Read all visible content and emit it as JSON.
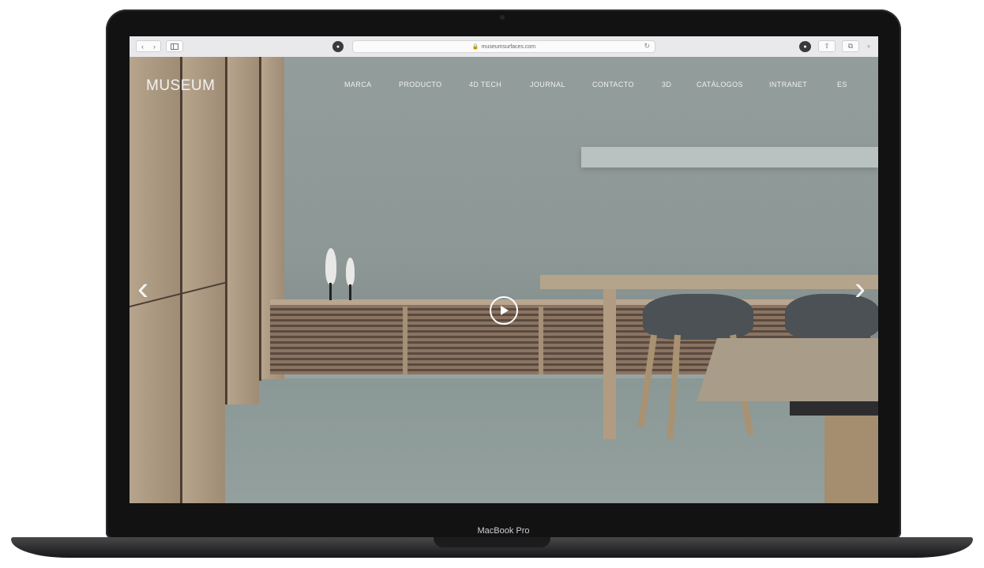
{
  "browser": {
    "url": "museumsurfaces.com",
    "back_icon": "chevron-left-icon",
    "forward_icon": "chevron-right-icon",
    "sidebar_icon": "sidebar-icon",
    "reload_icon": "reload-icon"
  },
  "site": {
    "logo": "MUSEUM",
    "menu": [
      "MARCA",
      "PRODUCTO",
      "4D TECH",
      "JOURNAL",
      "CONTACTO",
      "3D",
      "CATÁLOGOS",
      "INTRANET",
      "ES"
    ]
  },
  "hero": {
    "prev_arrow": "‹",
    "next_arrow": "›",
    "play_icon": "play-icon"
  },
  "device": {
    "model": "MacBook Pro"
  },
  "colors": {
    "frame": "#121213",
    "hero_wall": "#8d9896",
    "wood": "#b19c82",
    "nav_text": "#f0f0f0"
  }
}
